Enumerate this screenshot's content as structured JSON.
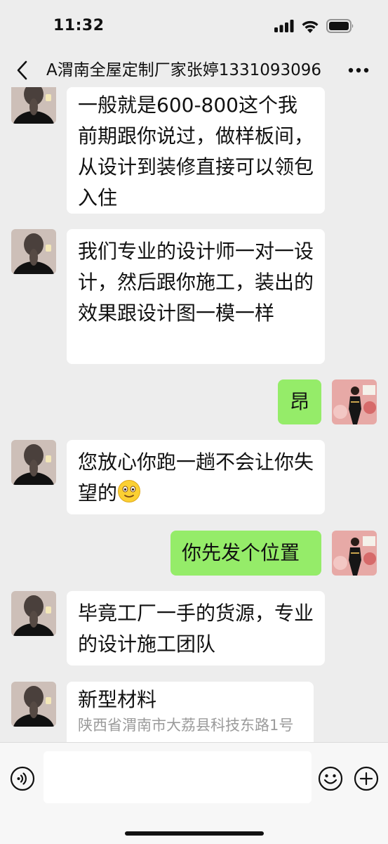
{
  "status_bar": {
    "time": "11:32"
  },
  "nav": {
    "title": "A渭南全屋定制厂家张婷1331093096"
  },
  "messages": [
    {
      "side": "left",
      "avatar": "woman-back-avatar",
      "text": "一般就是600-800这个我前期跟你说过，做样板间，从设计到装修直接可以领包入住"
    },
    {
      "side": "left",
      "avatar": "woman-back-avatar",
      "text": "我们专业的设计师一对一设计，然后跟你施工，装出的效果跟设计图一模一样"
    },
    {
      "side": "right",
      "avatar": "self-avatar",
      "text": "昂"
    },
    {
      "side": "left",
      "avatar": "woman-back-avatar",
      "text": "您放心你跑一趟不会让你失望的",
      "emoji": "smiling-face-emoji"
    },
    {
      "side": "right",
      "avatar": "self-avatar",
      "text": "你先发个位置"
    },
    {
      "side": "left",
      "avatar": "woman-back-avatar",
      "text": "毕竟工厂一手的货源，专业的设计施工团队"
    },
    {
      "side": "left",
      "avatar": "woman-back-avatar",
      "text": "新型材料",
      "subtext": "陕西省渭南市大荔县科技东路1号"
    }
  ],
  "colors": {
    "background": "#ededed",
    "bubble_self": "#95ec69",
    "bubble_other": "#ffffff"
  },
  "input_bar": {
    "placeholder": ""
  }
}
